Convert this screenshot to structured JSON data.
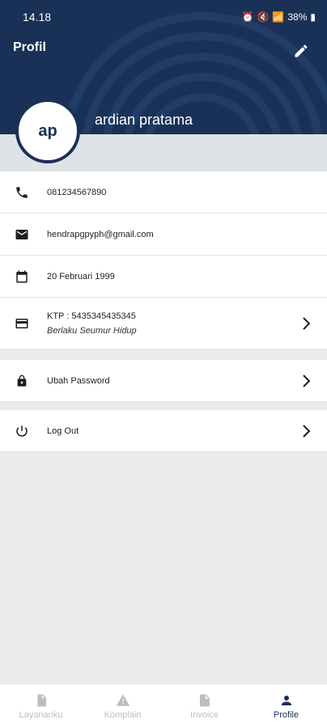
{
  "status": {
    "time": "14.18",
    "battery": "38%"
  },
  "header": {
    "title": "Profil",
    "edit_icon": "pencil-icon"
  },
  "profile": {
    "initials": "ap",
    "name": "ardian pratama"
  },
  "info": {
    "phone": "081234567890",
    "email": "hendrapgpyph@gmail.com",
    "birthdate": "20 Februari 1999",
    "ktp": "KTP : 5435345435345",
    "ktp_validity": "Berlaku Seumur Hidup"
  },
  "actions": {
    "change_password": "Ubah Password",
    "logout": "Log Out"
  },
  "nav": [
    {
      "label": "Layananku",
      "icon": "service-icon"
    },
    {
      "label": "Komplain",
      "icon": "warning-icon"
    },
    {
      "label": "Invoice",
      "icon": "document-icon"
    },
    {
      "label": "Profile",
      "icon": "person-icon"
    }
  ],
  "colors": {
    "primary": "#1a3157",
    "background": "#ebebeb",
    "inactive": "#bdbdbd"
  }
}
